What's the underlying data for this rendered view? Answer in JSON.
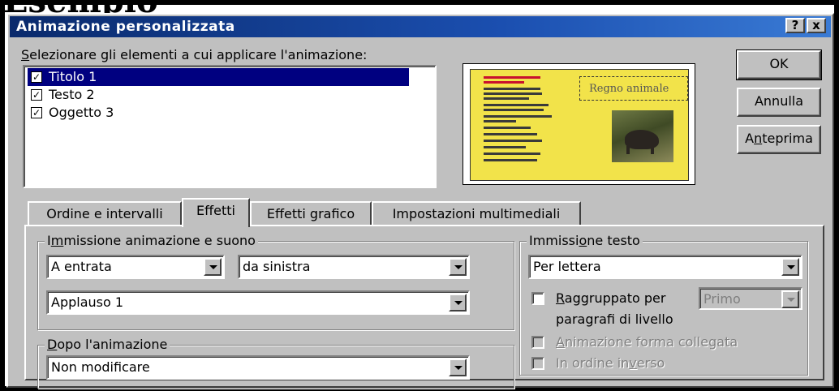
{
  "heading": "Esempio",
  "window": {
    "title": "Animazione personalizzata",
    "help_button": "?",
    "close_button": "x"
  },
  "select": {
    "label_prefix": "S",
    "label_rest": "elezionare gli elementi a cui applicare l'animazione:",
    "items": [
      {
        "label": "Titolo 1",
        "checked": true,
        "selected": true
      },
      {
        "label": "Testo 2",
        "checked": true,
        "selected": false
      },
      {
        "label": "Oggetto 3",
        "checked": true,
        "selected": false
      }
    ]
  },
  "preview": {
    "title_text": "Regno animale",
    "slide_color": "#f2e34a"
  },
  "buttons": {
    "ok": "OK",
    "cancel": "Annulla",
    "preview_pre": "A",
    "preview_u": "n",
    "preview_post": "teprima"
  },
  "tabs": [
    {
      "label": "Ordine e intervalli",
      "active": false
    },
    {
      "label": "Effetti",
      "active": true
    },
    {
      "label": "Effetti grafico",
      "active": false
    },
    {
      "label": "Impostazioni multimediali",
      "active": false
    }
  ],
  "entry_group": {
    "label_pre": "I",
    "label_u": "m",
    "label_post": "missione animazione e suono",
    "effect": "A entrata",
    "direction": "da sinistra",
    "sound": "Applauso 1"
  },
  "after_group": {
    "label_u": "D",
    "label_post": "opo l'animazione",
    "value": "Non modificare"
  },
  "text_group": {
    "label_pre": "Immissi",
    "label_u": "o",
    "label_post": "ne testo",
    "value": "Per lettera",
    "group_by_u": "R",
    "group_by_post": "aggruppato per",
    "group_by_value": "Primo",
    "group_by_line2": "paragrafi di livello",
    "animate_shape_u": "A",
    "animate_shape_post": "nimazione forma collegata",
    "reverse_pre": "In ordine in",
    "reverse_u": "v",
    "reverse_post": "erso"
  },
  "colors": {
    "titlebar_start": "#0a2a6c",
    "titlebar_end": "#3a7bd5",
    "selection": "#000080",
    "face": "#c0c0c0"
  }
}
